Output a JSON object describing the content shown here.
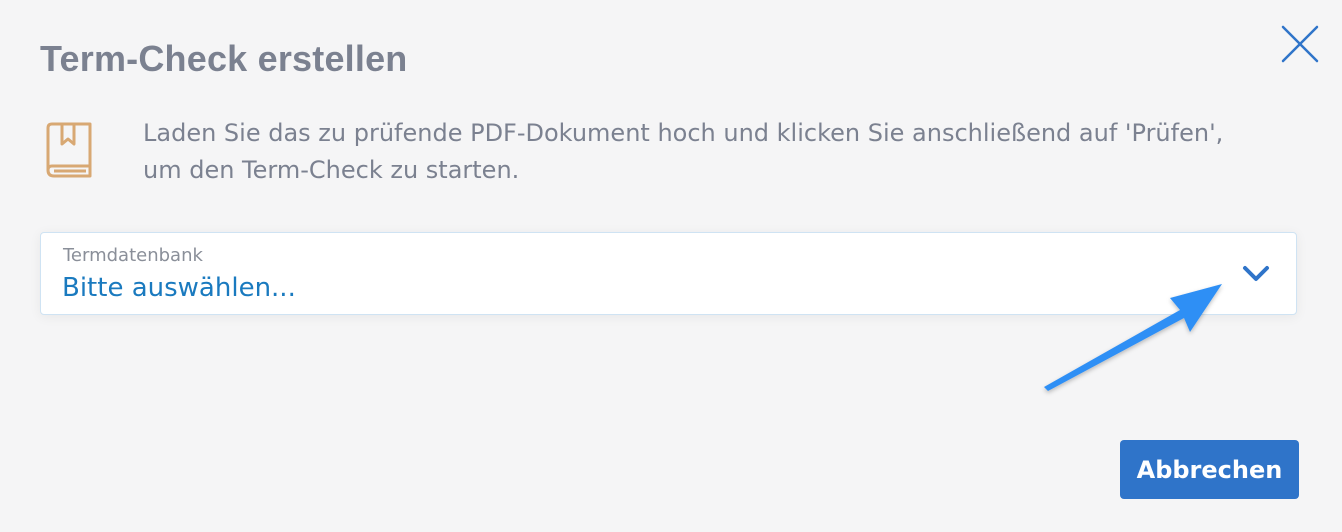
{
  "dialog": {
    "title": "Term-Check erstellen",
    "close_icon": "close-icon",
    "info_icon": "book-icon",
    "info_text": "Laden Sie das zu prüfende PDF-Dokument hoch und klicken Sie anschließend auf 'Prüfen', um den Term-Check zu starten."
  },
  "select": {
    "label": "Termdatenbank",
    "value": "Bitte auswählen...",
    "icon": "chevron-down-icon"
  },
  "footer": {
    "cancel_label": "Abbrechen"
  },
  "colors": {
    "title": "#7b8190",
    "accent": "#2f74c9",
    "select_value": "#1a7abf",
    "icon_book": "#d8a873",
    "annotation_arrow": "#2f8ff5"
  }
}
